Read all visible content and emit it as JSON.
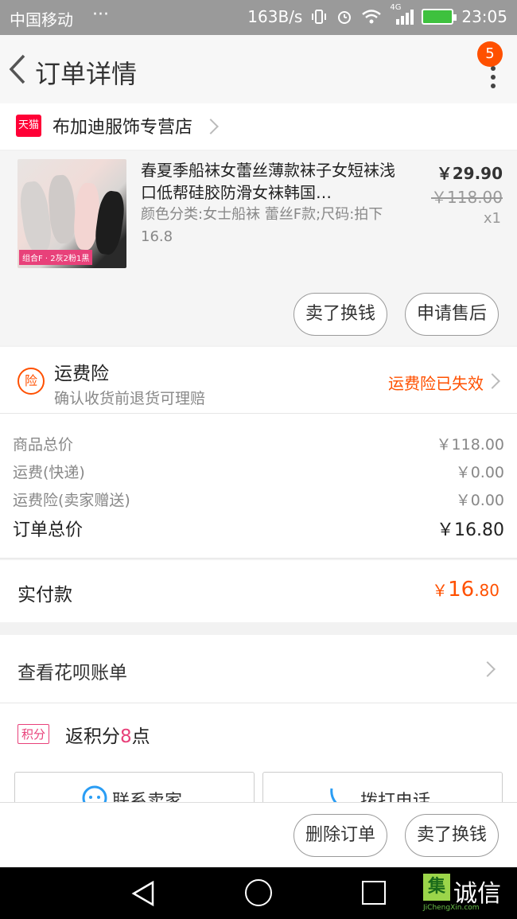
{
  "status_bar": {
    "carrier": "中国移动",
    "dots": "···",
    "speed": "163B/s",
    "network": "4G",
    "time": "23:05"
  },
  "nav": {
    "title": "订单详情",
    "badge": "5"
  },
  "shop": {
    "platform_icon": "天猫",
    "name": "布加迪服饰专营店"
  },
  "item": {
    "image_tag": "组合F · 2灰2粉1黑",
    "title": "春夏季船袜女蕾丝薄款袜子女短袜浅口低帮硅胶防滑女袜韩国…",
    "spec": "颜色分类:女士船袜 蕾丝F款;尺码:拍下16.8",
    "price": "￥29.90",
    "original_price": "￥118.00",
    "quantity": "x1",
    "buttons": [
      "卖了换钱",
      "申请售后"
    ]
  },
  "insurance": {
    "icon_text": "险",
    "title": "运费险",
    "subtitle": "确认收货前退货可理赔",
    "status": "运费险已失效"
  },
  "summary": {
    "lines": [
      {
        "label": "商品总价",
        "value": "￥118.00"
      },
      {
        "label": "运费(快递)",
        "value": "￥0.00"
      },
      {
        "label": "运费险(卖家赠送)",
        "value": "￥0.00"
      }
    ],
    "total_label": "订单总价",
    "total_value": "￥16.80"
  },
  "paid": {
    "label": "实付款",
    "currency": "￥",
    "integer": "16",
    "decimal": ".80"
  },
  "huabei": {
    "label": "查看花呗账单"
  },
  "points": {
    "badge": "积分",
    "prefix": "返积分",
    "number": "8",
    "suffix": "点"
  },
  "contact": {
    "seller": "联系卖家",
    "call": "拨打电话"
  },
  "bottom_bar": {
    "delete": "删除订单",
    "resell": "卖了换钱"
  },
  "watermark": {
    "box": "集",
    "text": "诚信",
    "sub": "JiChengXin.com"
  },
  "colors": {
    "accent": "#ff5000",
    "tmall": "#ff0036",
    "points": "#e8417a"
  }
}
